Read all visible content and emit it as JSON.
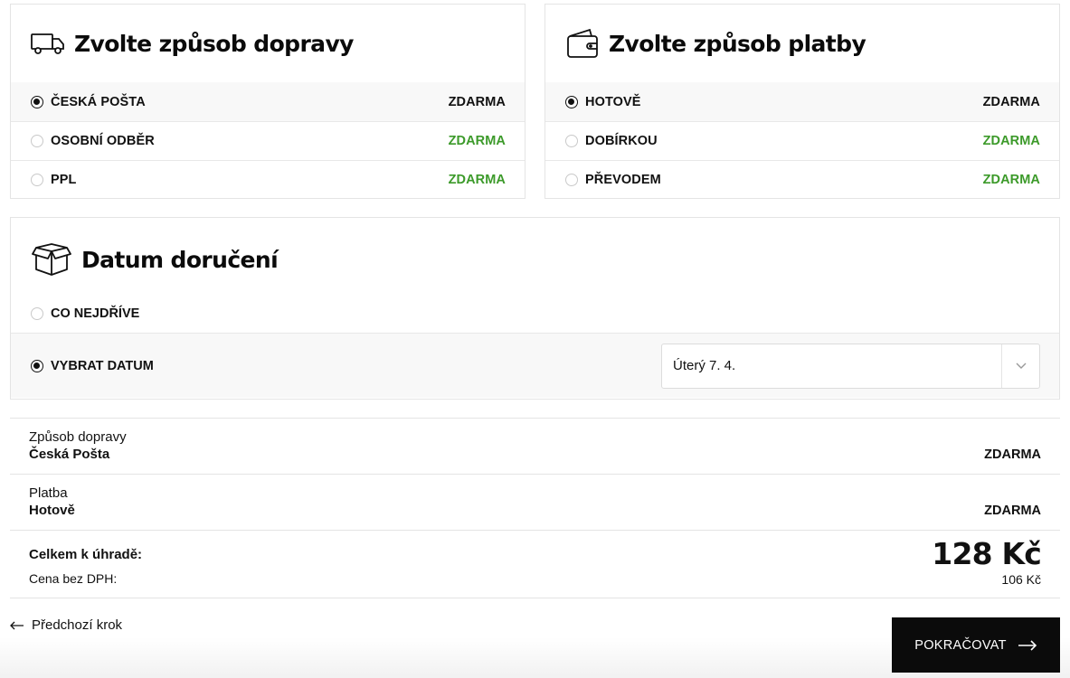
{
  "shipping": {
    "title": "Zvolte způsob dopravy",
    "icon": "truck-icon",
    "options": [
      {
        "label": "ČESKÁ POŠTA",
        "price": "ZDARMA",
        "selected": true
      },
      {
        "label": "OSOBNÍ ODBĚR",
        "price": "ZDARMA",
        "selected": false
      },
      {
        "label": "PPL",
        "price": "ZDARMA",
        "selected": false
      }
    ]
  },
  "payment": {
    "title": "Zvolte způsob platby",
    "icon": "wallet-icon",
    "options": [
      {
        "label": "HOTOVĚ",
        "price": "ZDARMA",
        "selected": true
      },
      {
        "label": "DOBÍRKOU",
        "price": "ZDARMA",
        "selected": false
      },
      {
        "label": "PŘEVODEM",
        "price": "ZDARMA",
        "selected": false
      }
    ]
  },
  "delivery_date": {
    "title": "Datum doručení",
    "icon": "box-icon",
    "asap_label": "CO NEJDŘÍVE",
    "choose_label": "VYBRAT DATUM",
    "selected_date": "Úterý 7. 4."
  },
  "summary": {
    "shipping_label": "Způsob dopravy",
    "shipping_value": "Česká Pošta",
    "shipping_price": "ZDARMA",
    "payment_label": "Platba",
    "payment_value": "Hotově",
    "payment_price": "ZDARMA",
    "total_label": "Celkem k úhradě:",
    "total_value": "128 Kč",
    "net_label": "Cena bez DPH:",
    "net_value": "106 Kč"
  },
  "nav": {
    "back_label": "Předchozí krok",
    "continue_label": "POKRAČOVAT"
  },
  "colors": {
    "accent_green": "#3c9a2a",
    "button_bg": "#0b0b0b"
  }
}
